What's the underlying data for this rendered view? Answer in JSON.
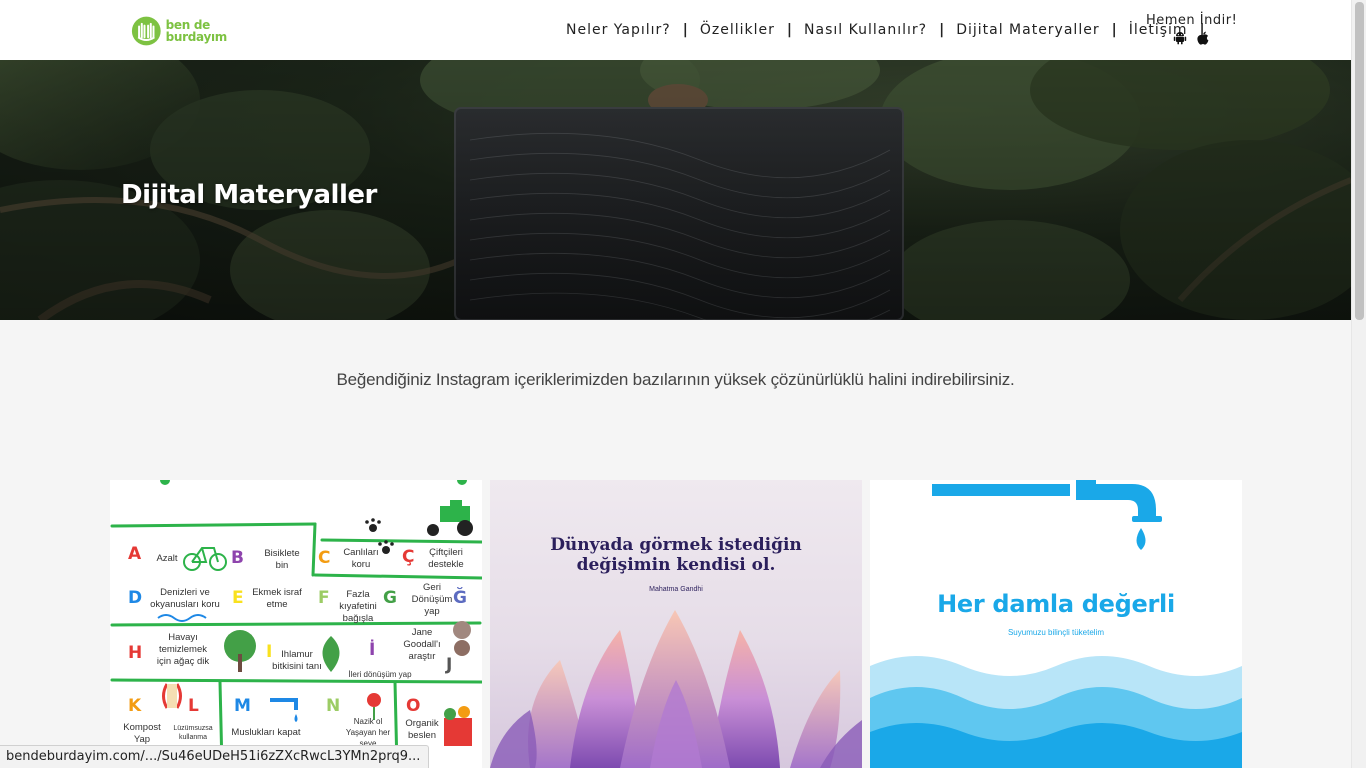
{
  "brand": {
    "line1": "ben de",
    "line2": "burdayım",
    "color": "#7dc242"
  },
  "nav": {
    "items": [
      "Neler Yapılır?",
      "Özellikler",
      "Nasıl Kullanılır?",
      "Dijital Materyaller",
      "İletişim"
    ],
    "download_label": "Hemen İndir!",
    "store_icons": [
      "android-icon",
      "apple-icon"
    ]
  },
  "hero": {
    "title": "Dijital Materyaller"
  },
  "intro": {
    "text": "Beğendiğiniz Instagram içeriklerimizden bazılarının yüksek çözünürlüklü halini indirebilirsiniz."
  },
  "cards": {
    "alphabet": {
      "cells": [
        {
          "letter": "A",
          "text": "Azalt",
          "color": "#e53935"
        },
        {
          "letter": "B",
          "text": "Bisiklete bin",
          "color": "#8e44ad"
        },
        {
          "letter": "C",
          "text": "Canlıları koru",
          "color": "#f39c12"
        },
        {
          "letter": "Ç",
          "text": "Çiftçileri destekle",
          "color": "#e53935"
        },
        {
          "letter": "D",
          "text": "Denizleri ve okyanusları koru",
          "color": "#1e88e5"
        },
        {
          "letter": "E",
          "text": "Ekmek israf etme",
          "color": "#f9e11e"
        },
        {
          "letter": "F",
          "text": "Fazla kıyafetini bağışla",
          "color": "#9ccc65"
        },
        {
          "letter": "G",
          "text": "Geri Dönüşüm yap",
          "color": "#43a047"
        },
        {
          "letter": "Ğ",
          "text": "",
          "color": "#5c6bc0"
        },
        {
          "letter": "H",
          "text": "Havayı temizlemek için ağaç dik",
          "color": "#e53935"
        },
        {
          "letter": "I",
          "text": "Ihlamur bitkisini tanı",
          "color": "#f9e11e"
        },
        {
          "letter": "İ",
          "text": "İleri dönüşüm yap",
          "color": "#8e44ad"
        },
        {
          "letter": "J",
          "text": "Jane Goodall'ı araştır",
          "color": "#555555"
        },
        {
          "letter": "K",
          "text": "Kompost Yap",
          "color": "#f39c12"
        },
        {
          "letter": "L",
          "text": "Lüzümsuzsa kullanma",
          "color": "#e53935"
        },
        {
          "letter": "M",
          "text": "Muslukları kapat",
          "color": "#1e88e5"
        },
        {
          "letter": "N",
          "text": "Nazik ol Yaşayan her şeye",
          "color": "#9ccc65"
        },
        {
          "letter": "O",
          "text": "Organik beslen",
          "color": "#e53935"
        }
      ]
    },
    "quote": {
      "line1": "Dünyada görmek istediğin",
      "line2": "değişimin kendisi ol.",
      "author": "Mahatma Gandhi"
    },
    "water": {
      "title": "Her damla değerli",
      "subtitle": "Suyumuzu bilinçli tüketelim"
    }
  },
  "status_bar": {
    "text": "bendeburdayim.com/.../Su46eUDeH51i6zZXcRwcL3YMn2prq9..."
  }
}
